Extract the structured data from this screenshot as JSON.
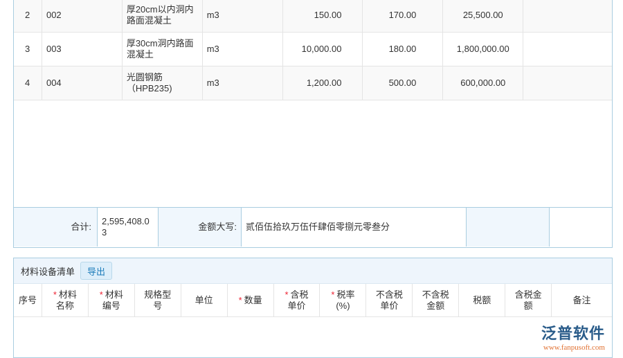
{
  "items": [
    {
      "no": "2",
      "code": "002",
      "name": "厚20cm以内洞内路面混凝土",
      "unit": "m3",
      "qty": "150.00",
      "price": "170.00",
      "amount": "25,500.00"
    },
    {
      "no": "3",
      "code": "003",
      "name": "厚30cm洞内路面混凝土",
      "unit": "m3",
      "qty": "10,000.00",
      "price": "180.00",
      "amount": "1,800,000.00"
    },
    {
      "no": "4",
      "code": "004",
      "name": "光圆钢筋（HPB235)",
      "unit": "m3",
      "qty": "1,200.00",
      "price": "500.00",
      "amount": "600,000.00"
    }
  ],
  "summary": {
    "total_label": "合计:",
    "total": "2,595,408.03",
    "upper_label": "金额大写:",
    "upper": "贰佰伍拾玖万伍仟肆佰零捌元零叁分"
  },
  "materials": {
    "title": "材料设备清单",
    "export": "导出",
    "columns": [
      {
        "l": "序号",
        "r": false
      },
      {
        "l": "材料名称",
        "r": true
      },
      {
        "l": "材料编号",
        "r": true
      },
      {
        "l": "规格型号",
        "r": false
      },
      {
        "l": "单位",
        "r": false
      },
      {
        "l": "数量",
        "r": true
      },
      {
        "l": "含税单价",
        "r": true
      },
      {
        "l": "税率(%)",
        "r": true
      },
      {
        "l": "不含税单价",
        "r": false
      },
      {
        "l": "不含税金额",
        "r": false
      },
      {
        "l": "税额",
        "r": false
      },
      {
        "l": "含税金额",
        "r": false
      },
      {
        "l": "备注",
        "r": false
      }
    ]
  },
  "watermark": {
    "brand": "泛普软件",
    "url": "www.fanpusoft.com"
  }
}
